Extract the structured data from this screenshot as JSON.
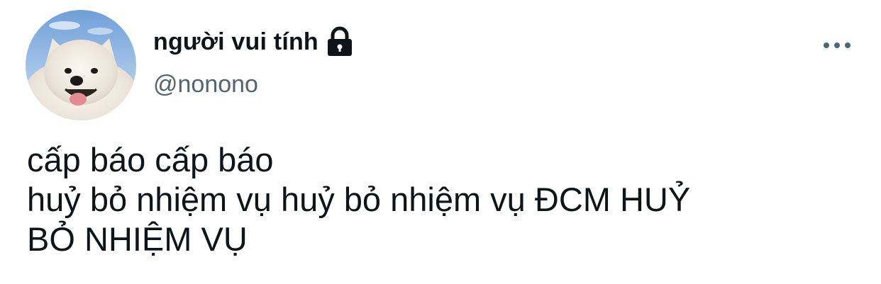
{
  "user": {
    "display_name": "người vui tính",
    "handle": "@nonono",
    "avatar_icon": "samoyed-dog-avatar",
    "protected_icon": "lock-icon"
  },
  "actions": {
    "more_icon": "more-horizontal-icon"
  },
  "tweet": {
    "text": "cấp báo cấp báo\nhuỷ bỏ nhiệm vụ huỷ bỏ nhiệm vụ ĐCM HUỶ\nBỎ NHIỆM VỤ"
  },
  "colors": {
    "text_primary": "#0f1419",
    "text_secondary": "#536471",
    "icon_gray": "#536471"
  }
}
